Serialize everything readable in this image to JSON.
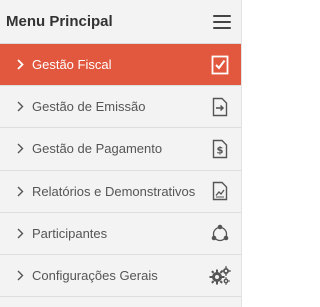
{
  "menu": {
    "title": "Menu Principal",
    "items": [
      {
        "label": "Gestão Fiscal",
        "icon": "document-check-icon",
        "active": true
      },
      {
        "label": "Gestão de Emissão",
        "icon": "document-arrow-icon",
        "active": false
      },
      {
        "label": "Gestão de Pagamento",
        "icon": "document-dollar-icon",
        "active": false
      },
      {
        "label": "Relatórios e Demonstrativos",
        "icon": "document-chart-icon",
        "active": false
      },
      {
        "label": "Participantes",
        "icon": "network-icon",
        "active": false
      },
      {
        "label": "Configurações Gerais",
        "icon": "gears-icon",
        "active": false
      }
    ]
  },
  "colors": {
    "active_background": "#e2583e",
    "menu_background": "#f3f3f3",
    "text": "#555555"
  }
}
